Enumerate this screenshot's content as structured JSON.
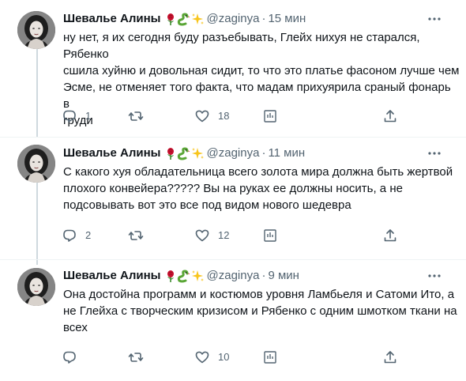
{
  "tweets": [
    {
      "author": "Шевалье Алины",
      "emoji": [
        "rose",
        "snake",
        "sparkles"
      ],
      "handle": "@zaginya",
      "separator": "·",
      "time": "15 мин",
      "text": "ну нет, я их сегодня буду разъебывать, Глейх нихуя не старался, Рябенко\nсшила хуйню и довольная сидит, то что это платье фасоном лучше чем\nЭсме, не отменяет того факта, что мадам прихуярила сраный фонарь в\nгруди",
      "replies": "1",
      "retweets": "",
      "likes": "18"
    },
    {
      "author": "Шевалье Алины",
      "emoji": [
        "rose",
        "snake",
        "sparkles"
      ],
      "handle": "@zaginya",
      "separator": "·",
      "time": "11 мин",
      "text": "С какого хуя обладательница всего золота мира должна быть жертвой\nплохого конвейера????? Вы на руках ее должны носить, а не\nподсовывать вот это все под видом нового шедевра",
      "replies": "2",
      "retweets": "",
      "likes": "12"
    },
    {
      "author": "Шевалье Алины",
      "emoji": [
        "rose",
        "snake",
        "sparkles"
      ],
      "handle": "@zaginya",
      "separator": "·",
      "time": "9 мин",
      "text": "Она достойна программ и костюмов уровня Ламбьеля и Сатоми Ито, а\nне Глейха с творческим кризисом и Рябенко с одним шмотком ткани на\nвсех",
      "replies": "",
      "retweets": "",
      "likes": "10"
    }
  ],
  "colors": {
    "text": "#0f1419",
    "secondary": "#536471",
    "thread_line": "#cfd9de",
    "divider": "#eff3f4"
  }
}
